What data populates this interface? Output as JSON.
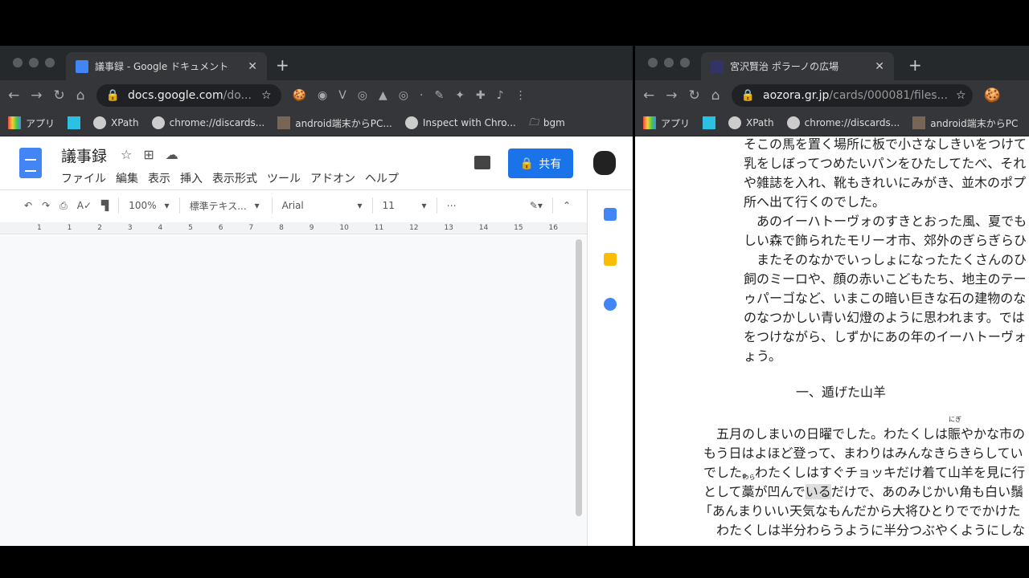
{
  "left_window": {
    "tab_title": "議事録 - Google ドキュメント",
    "url_host": "docs.google.com",
    "url_rest": "/do...",
    "bookmarks": [
      "アプリ",
      "XPath",
      "chrome://discards...",
      "android端末からPC...",
      "Inspect with Chro...",
      "bgm"
    ],
    "doc_title": "議事録",
    "menu": [
      "ファイル",
      "編集",
      "表示",
      "挿入",
      "表示形式",
      "ツール",
      "アドオン",
      "ヘルプ"
    ],
    "share_label": "共有",
    "zoom": "100%",
    "style": "標準テキス...",
    "font": "Arial",
    "font_size": "11",
    "more": "⋯",
    "ruler": [
      "1",
      "1",
      "2",
      "3",
      "4",
      "5",
      "6",
      "7",
      "8",
      "9",
      "10",
      "11",
      "12",
      "13",
      "14",
      "15",
      "16"
    ]
  },
  "right_window": {
    "tab_title": "宮沢賢治 ポラーノの広場",
    "url_host": "aozora.gr.jp",
    "url_rest": "/cards/000081/files...",
    "bookmarks": [
      "アプリ",
      "XPath",
      "chrome://discards...",
      "android端末からPC"
    ],
    "lines": [
      "そこの馬を置く場所に板で小さなしきいをつけて",
      "乳をしぼってつめたいパンをひたしてたべ、それ",
      "や雑誌を入れ、靴もきれいにみがき、並木のポプ",
      "所へ出て行くのでした。",
      "　あのイーハトーヴォのすきとおった風、夏でも",
      "しい森で飾られたモリーオ市、郊外のぎらぎらひ",
      "　またそのなかでいっしょになったたくさんのひ",
      "飼のミーロや、顔の赤いこどもたち、地主のテー",
      "ゥパーゴなど、いまこの暗い巨きな石の建物のな",
      "のなつかしい青い幻燈のように思われます。では",
      "をつけながら、しずかにあの年のイーハトーヴォ",
      "ょう。"
    ],
    "heading": "一、遁げた山羊",
    "p1a": "　五月のしまいの日曜でした。わたくしは",
    "ruby1_base": "賑",
    "ruby1": "にぎ",
    "p1b": "やかな市の",
    "p2": "もう日はよほど登って、まわりはみんなきらきらしてい",
    "p3": "でした。わたくしはすぐチョッキだけ着て山羊を見に行",
    "p4a": "として",
    "ruby2_base": "藁",
    "ruby2": "わら",
    "p4b": "が凹んで",
    "p4hl": "いる",
    "p4c": "だけで、あのみじかい角も白い鬚",
    "p5": "「あんまりいい天気なもんだから大将ひとりででかけた",
    "p6": "　わたくしは半分わらうように半分つぶやくようにしな"
  }
}
